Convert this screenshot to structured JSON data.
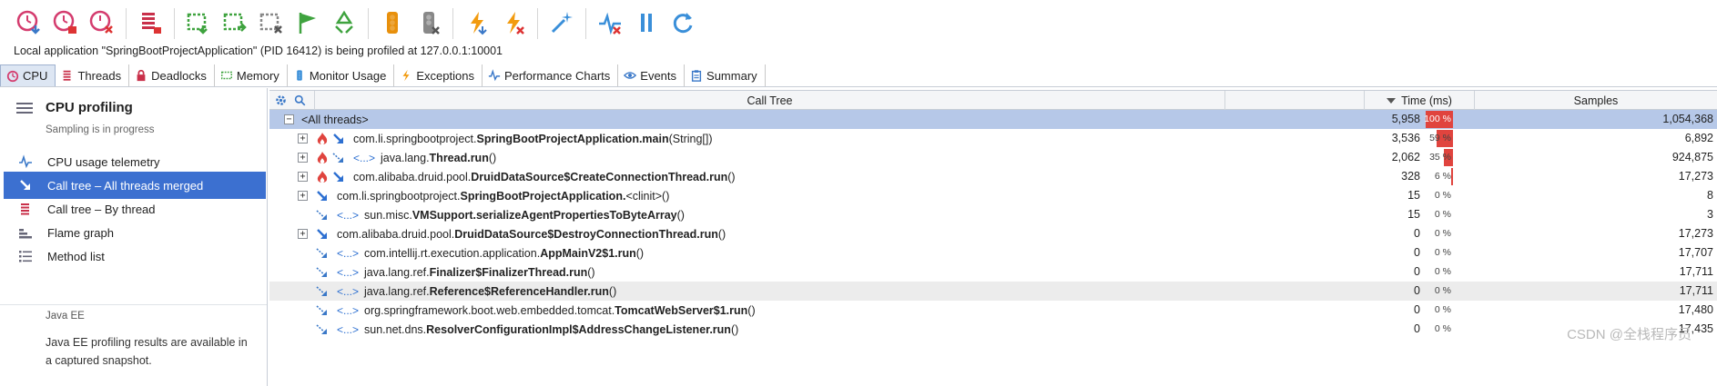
{
  "toolbar": {
    "buttons": [
      {
        "name": "cpu-recording-start-icon",
        "color": "#d43c6e"
      },
      {
        "name": "cpu-recording-stop-icon",
        "color": "#d43c6e"
      },
      {
        "name": "cpu-recording-clear-icon",
        "color": "#d43c6e"
      },
      {
        "name": "thread-dump-icon",
        "color": "#c9304a"
      },
      {
        "name": "snapshot-save-icon",
        "color": "#3fa33f"
      },
      {
        "name": "snapshot-export-icon",
        "color": "#3fa33f"
      },
      {
        "name": "snapshot-delete-icon",
        "color": "#888888"
      },
      {
        "name": "mark-flag-icon",
        "color": "#3fa33f"
      },
      {
        "name": "garbage-collect-icon",
        "color": "#3fa33f"
      },
      {
        "name": "traffic-light-icon",
        "color": "#e8900c"
      },
      {
        "name": "traffic-light-off-icon",
        "color": "#888888"
      },
      {
        "name": "trigger-icon",
        "color": "#f29b0f"
      },
      {
        "name": "trigger-delete-icon",
        "color": "#f29b0f"
      },
      {
        "name": "magic-wand-icon",
        "color": "#3a8fd9"
      },
      {
        "name": "telemetry-off-icon",
        "color": "#3a8fd9"
      },
      {
        "name": "pause-icon",
        "color": "#3a8fd9"
      },
      {
        "name": "refresh-icon",
        "color": "#3a8fd9"
      }
    ]
  },
  "status_text": "Local application \"SpringBootProjectApplication\" (PID 16412) is being profiled at 127.0.0.1:10001",
  "tabs": [
    {
      "label": "CPU",
      "icon": "cpu-clock-icon",
      "active": true
    },
    {
      "label": "Threads",
      "icon": "threads-icon",
      "active": false
    },
    {
      "label": "Deadlocks",
      "icon": "lock-icon",
      "active": false
    },
    {
      "label": "Memory",
      "icon": "memory-chip-icon",
      "active": false
    },
    {
      "label": "Monitor Usage",
      "icon": "traffic-light-icon",
      "active": false
    },
    {
      "label": "Exceptions",
      "icon": "lightning-icon",
      "active": false
    },
    {
      "label": "Performance Charts",
      "icon": "pulse-icon",
      "active": false
    },
    {
      "label": "Events",
      "icon": "eye-icon",
      "active": false
    },
    {
      "label": "Summary",
      "icon": "clipboard-icon",
      "active": false
    }
  ],
  "sidebar": {
    "title": "CPU profiling",
    "subtitle": "Sampling is in progress",
    "items": [
      {
        "label": "CPU usage telemetry",
        "icon": "pulse-icon",
        "active": false
      },
      {
        "label": "Call tree – All threads merged",
        "icon": "call-arrow-icon",
        "active": true
      },
      {
        "label": "Call tree – By thread",
        "icon": "threads-icon",
        "active": false
      },
      {
        "label": "Flame graph",
        "icon": "flame-graph-icon",
        "active": false
      },
      {
        "label": "Method list",
        "icon": "list-icon",
        "active": false
      }
    ],
    "section_label": "Java EE",
    "section_note": "Java EE profiling results are available in a captured snapshot."
  },
  "table": {
    "columns": {
      "tree": "Call Tree",
      "time": "Time (ms)",
      "samples": "Samples"
    },
    "rows": [
      {
        "indent": 0,
        "expander": "−",
        "icons": [],
        "thread_ref": "",
        "prefix": "",
        "bold": "<All threads>",
        "suffix": "",
        "time": "5,958",
        "pct": "100 %",
        "pct_val": 100,
        "samples": "1,054,368",
        "style": "sel"
      },
      {
        "indent": 1,
        "expander": "+",
        "icons": [
          "hot-spot-flame-icon",
          "call-arrow-icon"
        ],
        "thread_ref": "",
        "prefix": "com.li.springbootproject.",
        "bold": "SpringBootProjectApplication.main",
        "suffix": "(String[])",
        "time": "3,536",
        "pct": "59 %",
        "pct_val": 59,
        "samples": "6,892",
        "style": ""
      },
      {
        "indent": 1,
        "expander": "+",
        "icons": [
          "hot-spot-flame-icon",
          "thread-link-icon"
        ],
        "thread_ref": "<...>",
        "prefix": "java.lang.",
        "bold": "Thread.run",
        "suffix": "()",
        "time": "2,062",
        "pct": "35 %",
        "pct_val": 35,
        "samples": "924,875",
        "style": ""
      },
      {
        "indent": 1,
        "expander": "+",
        "icons": [
          "hot-spot-flame-icon",
          "call-arrow-icon"
        ],
        "thread_ref": "",
        "prefix": "com.alibaba.druid.pool.",
        "bold": "DruidDataSource$CreateConnectionThread.run",
        "suffix": "()",
        "time": "328",
        "pct": "6 %",
        "pct_val": 6,
        "samples": "17,273",
        "style": ""
      },
      {
        "indent": 1,
        "expander": "+",
        "icons": [
          "call-arrow-icon"
        ],
        "thread_ref": "",
        "prefix": "com.li.springbootproject.",
        "bold": "SpringBootProjectApplication.",
        "suffix": "<clinit>()",
        "time": "15",
        "pct": "0 %",
        "pct_val": 0,
        "samples": "8",
        "style": ""
      },
      {
        "indent": 2,
        "expander": "",
        "icons": [
          "thread-link-icon"
        ],
        "thread_ref": "<...>",
        "prefix": "sun.misc.",
        "bold": "VMSupport.serializeAgentPropertiesToByteArray",
        "suffix": "()",
        "time": "15",
        "pct": "0 %",
        "pct_val": 0,
        "samples": "3",
        "style": ""
      },
      {
        "indent": 1,
        "expander": "+",
        "icons": [
          "call-arrow-icon"
        ],
        "thread_ref": "",
        "prefix": "com.alibaba.druid.pool.",
        "bold": "DruidDataSource$DestroyConnectionThread.run",
        "suffix": "()",
        "time": "0",
        "pct": "0 %",
        "pct_val": 0,
        "samples": "17,273",
        "style": ""
      },
      {
        "indent": 2,
        "expander": "",
        "icons": [
          "thread-link-icon"
        ],
        "thread_ref": "<...>",
        "prefix": "com.intellij.rt.execution.application.",
        "bold": "AppMainV2$1.run",
        "suffix": "()",
        "time": "0",
        "pct": "0 %",
        "pct_val": 0,
        "samples": "17,707",
        "style": ""
      },
      {
        "indent": 2,
        "expander": "",
        "icons": [
          "thread-link-icon"
        ],
        "thread_ref": "<...>",
        "prefix": "java.lang.ref.",
        "bold": "Finalizer$FinalizerThread.run",
        "suffix": "()",
        "time": "0",
        "pct": "0 %",
        "pct_val": 0,
        "samples": "17,711",
        "style": ""
      },
      {
        "indent": 2,
        "expander": "",
        "icons": [
          "thread-link-icon"
        ],
        "thread_ref": "<...>",
        "prefix": "java.lang.ref.",
        "bold": "Reference$ReferenceHandler.run",
        "suffix": "()",
        "time": "0",
        "pct": "0 %",
        "pct_val": 0,
        "samples": "17,711",
        "style": "hl"
      },
      {
        "indent": 2,
        "expander": "",
        "icons": [
          "thread-link-icon"
        ],
        "thread_ref": "<...>",
        "prefix": "org.springframework.boot.web.embedded.tomcat.",
        "bold": "TomcatWebServer$1.run",
        "suffix": "()",
        "time": "0",
        "pct": "0 %",
        "pct_val": 0,
        "samples": "17,480",
        "style": ""
      },
      {
        "indent": 2,
        "expander": "",
        "icons": [
          "thread-link-icon"
        ],
        "thread_ref": "<...>",
        "prefix": "sun.net.dns.",
        "bold": "ResolverConfigurationImpl$AddressChangeListener.run",
        "suffix": "()",
        "time": "0",
        "pct": "0 %",
        "pct_val": 0,
        "samples": "17,435",
        "style": ""
      }
    ]
  },
  "watermark": "CSDN @全栈程序员",
  "colors": {
    "accent": "#3c70d0",
    "bar": "#e0443e",
    "selection": "#b6c8e8"
  }
}
